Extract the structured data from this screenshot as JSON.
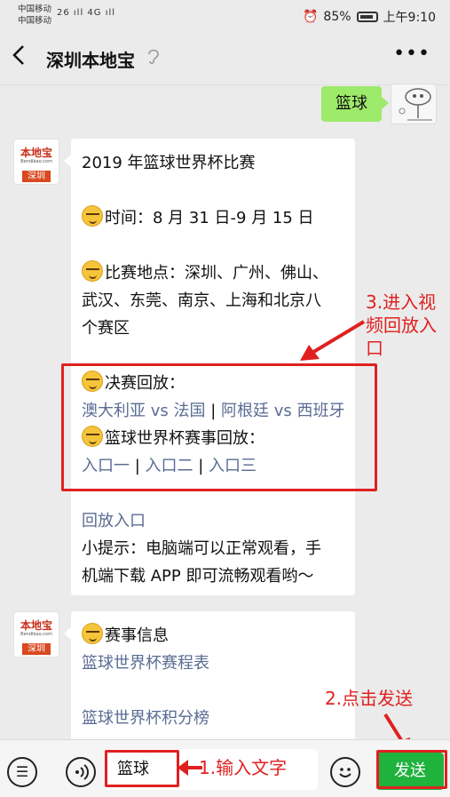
{
  "status_bar": {
    "carrier1": "中国移动",
    "carrier2": "中国移动",
    "signal_text": "26 ıll 4G ıll",
    "battery": "85%",
    "time": "上午9:10"
  },
  "header": {
    "title": "深圳本地宝"
  },
  "chat": {
    "user_message": "篮球",
    "bot_avatar": {
      "line1": "本地宝",
      "line2": "Bendibao.com",
      "line3": "深圳"
    },
    "message1": {
      "title": "2019 年篮球世界杯比赛",
      "time": "时间：8 月 31 日-9 月 15 日",
      "venue_1": "比赛地点：深圳、广州、佛山、",
      "venue_2": "武汉、东莞、南京、上海和北京八",
      "venue_3": "个赛区",
      "final_replay": "决赛回放：",
      "final_link1": "澳大利亚 vs 法国",
      "final_link2": "阿根廷 vs 西班牙",
      "replay_label": "篮球世界杯赛事回放：",
      "entry1": "入口一",
      "entry2": "入口二",
      "entry3": "入口三",
      "replay_entry": "回放入口",
      "tip_1": "小提示：电脑端可以正常观看，手",
      "tip_2": "机端下载 APP 即可流畅观看哟～"
    },
    "message2": {
      "title": "赛事信息",
      "link1": "篮球世界杯赛程表",
      "link2": "篮球世界杯积分榜"
    }
  },
  "annotations": {
    "step1": "1.输入文字",
    "step2": "2.点击发送",
    "step3_1": "3.进入视",
    "step3_2": "频回放入",
    "step3_3": "口"
  },
  "input_bar": {
    "text": "篮球",
    "send_label": "发送"
  },
  "colors": {
    "user_bubble": "#9eea6a",
    "link": "#5a6c93",
    "send": "#1fb23d",
    "annotation": "#e02020"
  }
}
